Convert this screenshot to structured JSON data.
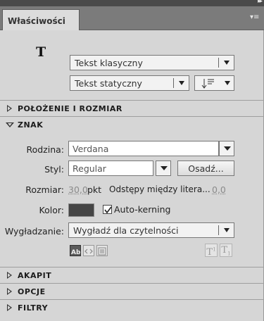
{
  "panel": {
    "tab_label": "Właściwości",
    "menu_icon": "panel-menu-icon",
    "collapse_icon": "double-chevron-right-icon"
  },
  "tool": {
    "icon_glyph": "T",
    "text_type": "Tekst klasyczny",
    "text_mode": "Tekst statyczny"
  },
  "sections": {
    "position_size": "POŁOŻENIE I ROZMIAR",
    "character": "ZNAK",
    "paragraph": "AKAPIT",
    "options": "OPCJE",
    "filters": "FILTRY"
  },
  "character": {
    "family_label": "Rodzina:",
    "family_value": "Verdana",
    "style_label": "Styl:",
    "style_value": "Regular",
    "embed_button": "Osadź...",
    "size_label": "Rozmiar:",
    "size_value": "30,0",
    "size_unit": "pkt",
    "spacing_label": "Odstępy między litera...",
    "spacing_value": "0,0",
    "color_label": "Kolor:",
    "color_value": "#454545",
    "autokern_label": "Auto-kerning",
    "autokern_checked": true,
    "aa_label": "Wygładzanie:",
    "aa_value": "Wygładź dla czytelności"
  },
  "colors": {
    "panel_bg": "#d6d6d6",
    "tabbar_bg": "#7b7b7b",
    "link_value": "#8a8a8a"
  }
}
